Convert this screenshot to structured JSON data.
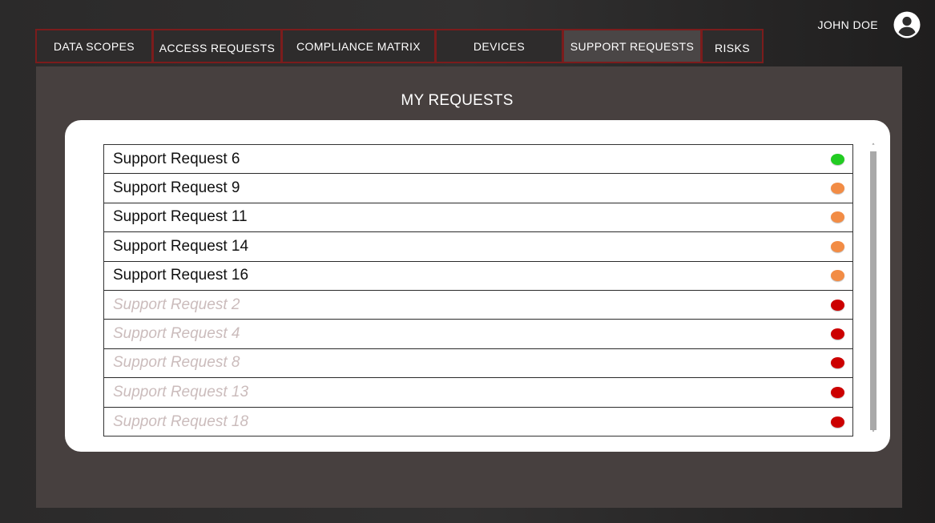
{
  "user": {
    "name": "JOHN DOE",
    "avatar_icon": "account-circle-icon"
  },
  "tabs": [
    {
      "label": "DATA SCOPES",
      "active": false
    },
    {
      "label": "ACCESS REQUESTS",
      "active": false
    },
    {
      "label": "COMPLIANCE MATRIX",
      "active": false
    },
    {
      "label": "DEVICES",
      "active": false
    },
    {
      "label": "SUPPORT REQUESTS",
      "active": true
    },
    {
      "label": "RISKS",
      "active": false
    }
  ],
  "main": {
    "title": "MY REQUESTS"
  },
  "status_colors": {
    "green": "#22cc22",
    "orange": "#f28c45",
    "red": "#cc0000"
  },
  "requests": [
    {
      "label": "Support Request 6",
      "status": "green",
      "closed": false
    },
    {
      "label": "Support Request 9",
      "status": "orange",
      "closed": false
    },
    {
      "label": "Support Request 11",
      "status": "orange",
      "closed": false
    },
    {
      "label": "Support Request 14",
      "status": "orange",
      "closed": false
    },
    {
      "label": "Support Request 16",
      "status": "orange",
      "closed": false
    },
    {
      "label": "Support Request 2",
      "status": "red",
      "closed": true
    },
    {
      "label": "Support Request 4",
      "status": "red",
      "closed": true
    },
    {
      "label": "Support Request 8",
      "status": "red",
      "closed": true
    },
    {
      "label": "Support Request 13",
      "status": "red",
      "closed": true
    },
    {
      "label": "Support Request 18",
      "status": "red",
      "closed": true
    }
  ],
  "scrollbar": {
    "up_icon": "chevron-up-icon",
    "down_icon": "chevron-down-icon"
  }
}
